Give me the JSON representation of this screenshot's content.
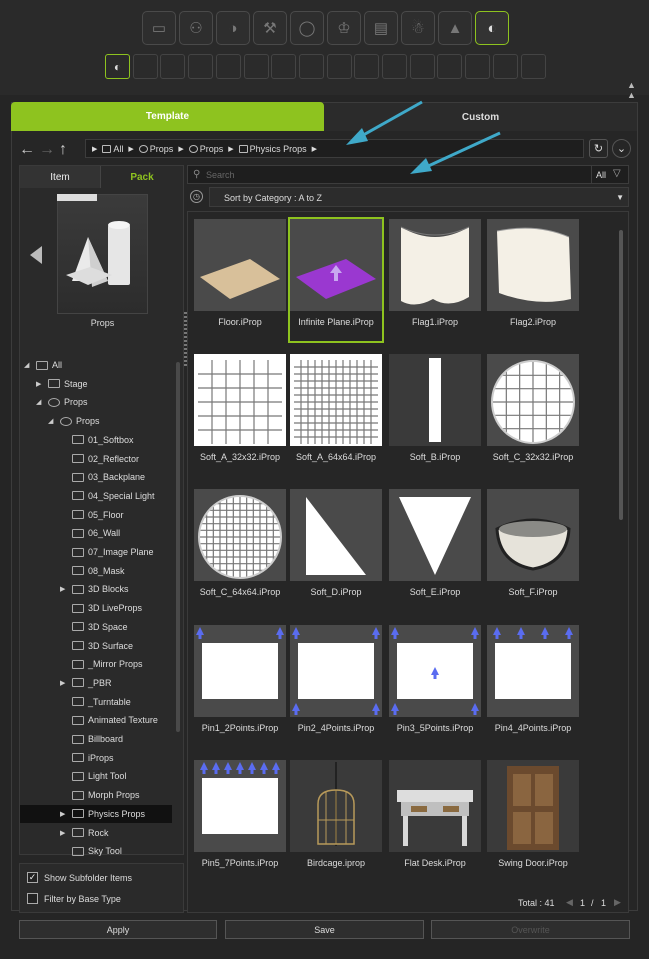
{
  "tabs": {
    "template": "Template",
    "custom": "Custom"
  },
  "breadcrumb": [
    {
      "label": "All",
      "icon": "folder-icon"
    },
    {
      "label": "Props",
      "icon": "props-icon"
    },
    {
      "label": "Props",
      "icon": "props-icon"
    },
    {
      "label": "Physics Props",
      "icon": "folder-icon"
    }
  ],
  "left_panel": {
    "tabs": {
      "item": "Item",
      "pack": "Pack"
    },
    "preview_caption": "Props",
    "tree": [
      {
        "label": "All",
        "expanded": true
      },
      {
        "label": "Stage",
        "expanded": false
      },
      {
        "label": "Props",
        "expanded": true
      },
      {
        "label": "Props",
        "expanded": true
      },
      {
        "label": "01_Softbox"
      },
      {
        "label": "02_Reflector"
      },
      {
        "label": "03_Backplane"
      },
      {
        "label": "04_Special Light"
      },
      {
        "label": "05_Floor"
      },
      {
        "label": "06_Wall"
      },
      {
        "label": "07_Image Plane"
      },
      {
        "label": "08_Mask"
      },
      {
        "label": "3D Blocks",
        "expandable": true
      },
      {
        "label": "3D LiveProps"
      },
      {
        "label": "3D Space"
      },
      {
        "label": "3D Surface"
      },
      {
        "label": "_Mirror Props"
      },
      {
        "label": "_PBR",
        "expandable": true
      },
      {
        "label": "_Turntable"
      },
      {
        "label": "Animated Texture"
      },
      {
        "label": "Billboard"
      },
      {
        "label": "iProps"
      },
      {
        "label": "Light Tool"
      },
      {
        "label": "Morph Props"
      },
      {
        "label": "Physics Props",
        "expandable": true,
        "selected": true
      },
      {
        "label": "Rock",
        "expandable": true
      },
      {
        "label": "Sky Tool"
      }
    ],
    "options": {
      "show_subfolder": "Show Subfolder Items",
      "show_subfolder_checked": true,
      "filter_base": "Filter by Base Type",
      "filter_base_checked": false
    }
  },
  "search": {
    "placeholder": "Search",
    "filter_label": "All"
  },
  "sort": {
    "label": "Sort by Category : A to Z"
  },
  "items": [
    {
      "name": "Floor.iProp"
    },
    {
      "name": "Infinite Plane.iProp",
      "selected": true
    },
    {
      "name": "Flag1.iProp"
    },
    {
      "name": "Flag2.iProp"
    },
    {
      "name": "Soft_A_32x32.iProp"
    },
    {
      "name": "Soft_A_64x64.iProp"
    },
    {
      "name": "Soft_B.iProp"
    },
    {
      "name": "Soft_C_32x32.iProp"
    },
    {
      "name": "Soft_C_64x64.iProp"
    },
    {
      "name": "Soft_D.iProp"
    },
    {
      "name": "Soft_E.iProp"
    },
    {
      "name": "Soft_F.iProp"
    },
    {
      "name": "Pin1_2Points.iProp"
    },
    {
      "name": "Pin2_4Points.iProp"
    },
    {
      "name": "Pin3_5Points.iProp"
    },
    {
      "name": "Pin4_4Points.iProp"
    },
    {
      "name": "Pin5_7Points.iProp"
    },
    {
      "name": "Birdcage.iprop"
    },
    {
      "name": "Flat Desk.iProp"
    },
    {
      "name": "Swing Door.iProp"
    }
  ],
  "footer": {
    "total": "Total : 41",
    "page": "1",
    "sep": "/",
    "pages": "1"
  },
  "buttons": {
    "apply": "Apply",
    "save": "Save",
    "overwrite": "Overwrite"
  },
  "colors": {
    "accent": "#8ec31f",
    "callout": "#3fa9c9",
    "pin": "#5a6cf0"
  }
}
